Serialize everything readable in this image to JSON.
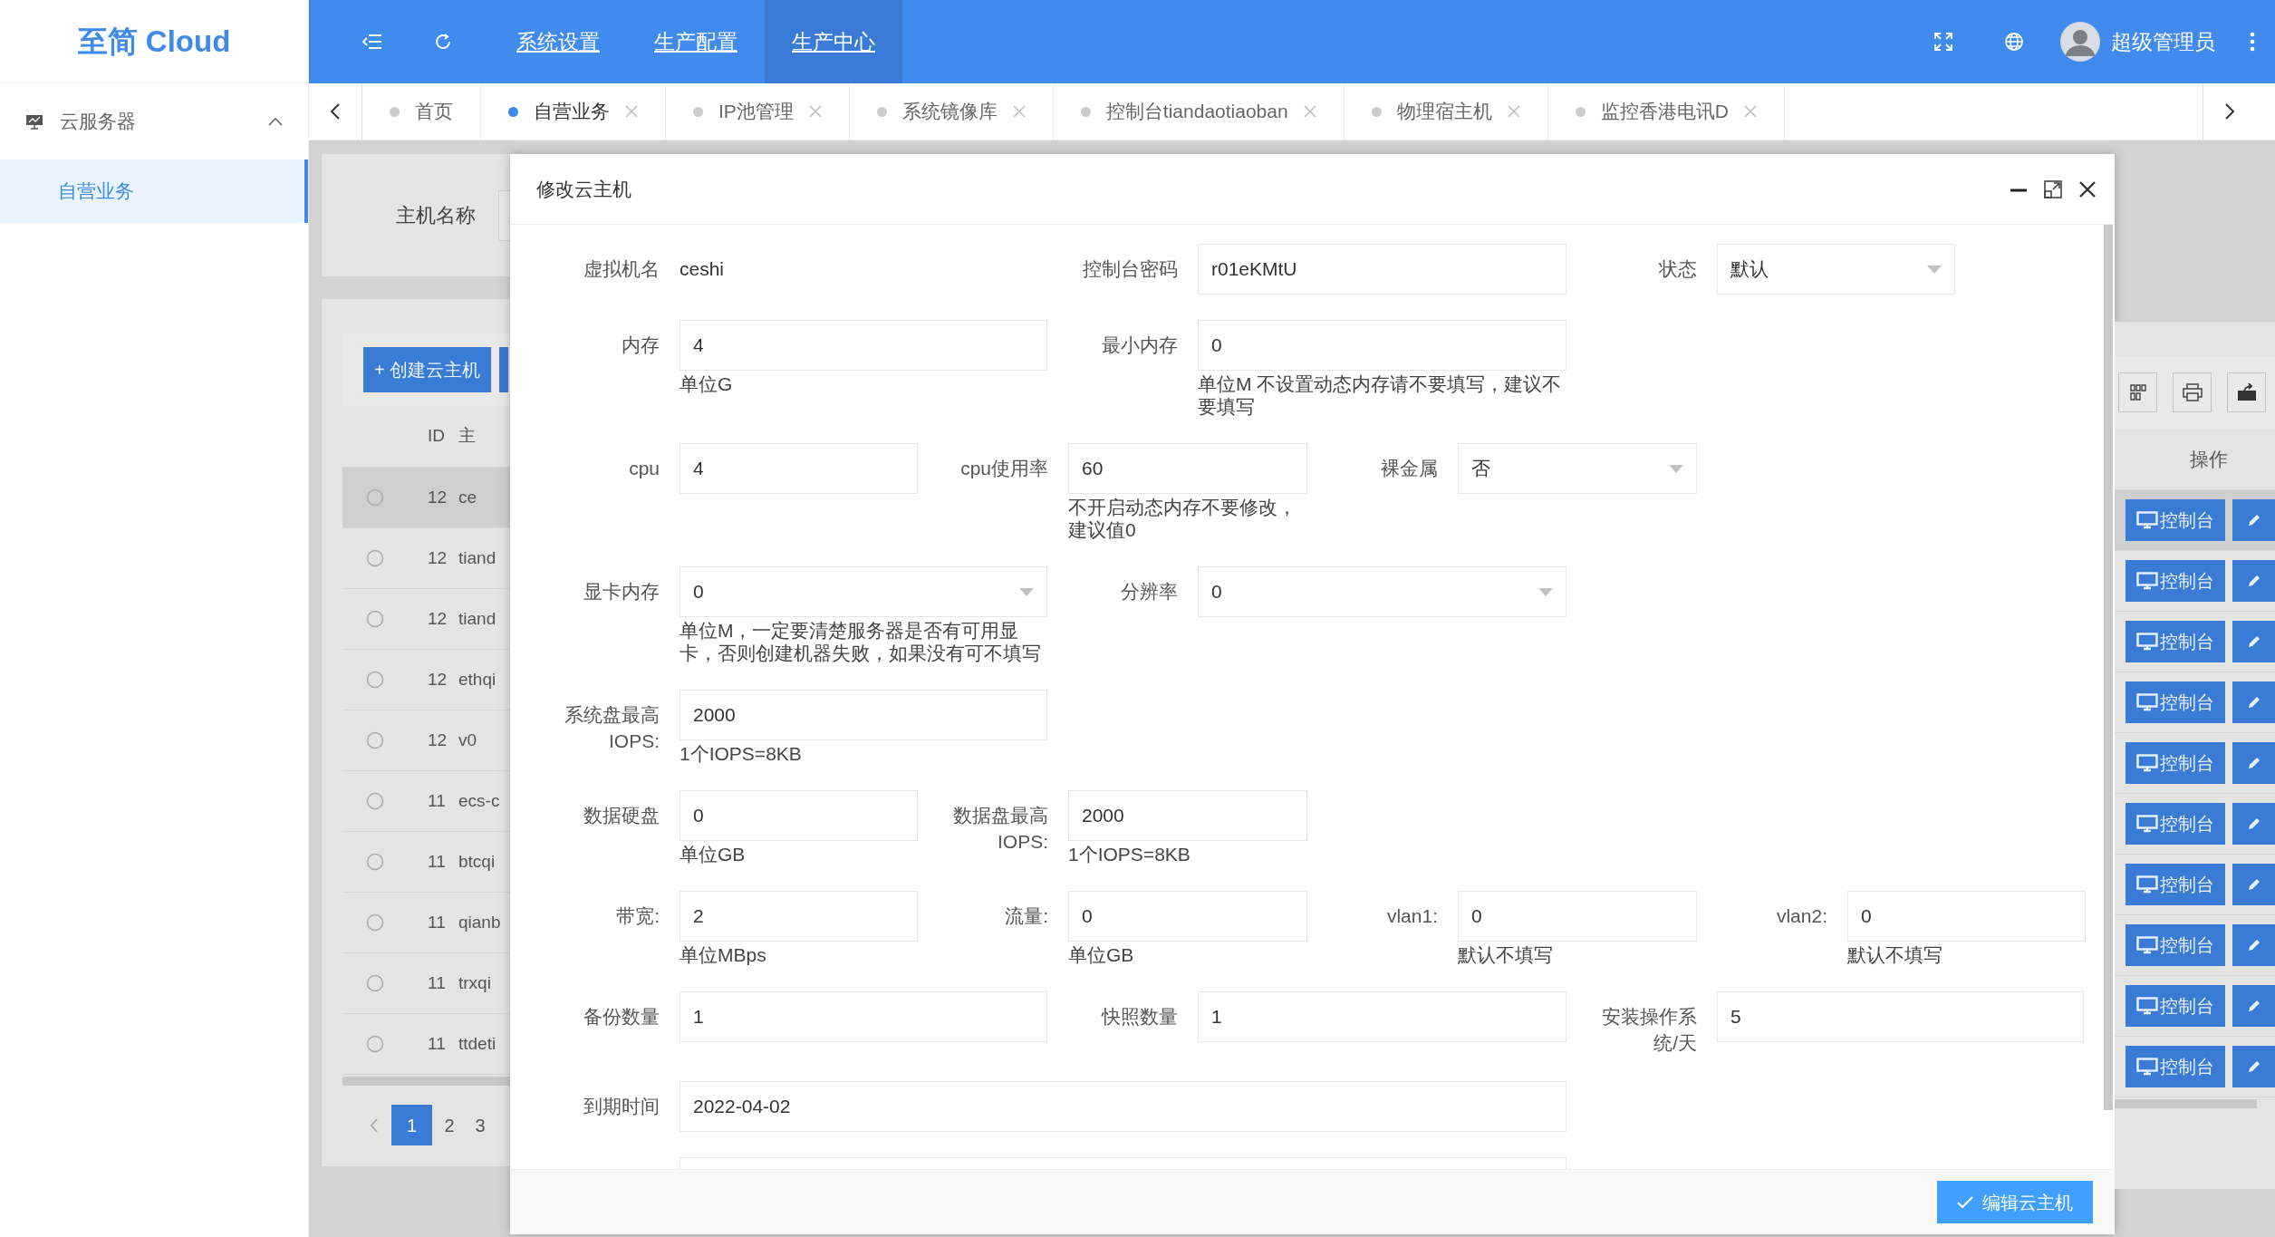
{
  "app": {
    "logo": "至简 Cloud"
  },
  "header": {
    "nav": [
      {
        "label": "系统设置",
        "selected": false
      },
      {
        "label": "生产配置",
        "selected": false
      },
      {
        "label": "生产中心",
        "selected": true
      }
    ],
    "user": "超级管理员"
  },
  "sidebar": {
    "groups": [
      {
        "label": "云服务器",
        "expanded": true,
        "children": [
          {
            "label": "自营业务",
            "selected": true
          }
        ]
      }
    ]
  },
  "tabs": [
    {
      "label": "首页",
      "selected": false,
      "closable": false
    },
    {
      "label": "自营业务",
      "selected": true,
      "closable": true
    },
    {
      "label": "IP池管理",
      "selected": false,
      "closable": true
    },
    {
      "label": "系统镜像库",
      "selected": false,
      "closable": true
    },
    {
      "label": "控制台tiandaotiaoban",
      "selected": false,
      "closable": true
    },
    {
      "label": "物理宿主机",
      "selected": false,
      "closable": true
    },
    {
      "label": "监控香港电讯D",
      "selected": false,
      "closable": true
    }
  ],
  "background": {
    "filter_label": "主机名称",
    "create_button": "+ 创建云主机",
    "columns": [
      "ID",
      "主"
    ],
    "action_column": "操作",
    "rows": [
      {
        "id": "12",
        "name": "ce",
        "highlighted": true,
        "checked": false,
        "action": "控制台"
      },
      {
        "id": "12",
        "name": "tiand",
        "highlighted": false,
        "checked": false,
        "action": "控制台"
      },
      {
        "id": "12",
        "name": "tiand",
        "highlighted": false,
        "checked": false,
        "action": "控制台"
      },
      {
        "id": "12",
        "name": "ethqi",
        "highlighted": false,
        "checked": false,
        "action": "控制台"
      },
      {
        "id": "12",
        "name": "v0",
        "highlighted": false,
        "checked": false,
        "action": "控制台"
      },
      {
        "id": "11",
        "name": "ecs-c",
        "highlighted": false,
        "checked": false,
        "action": "控制台"
      },
      {
        "id": "11",
        "name": "btcqi",
        "highlighted": false,
        "checked": false,
        "action": "控制台"
      },
      {
        "id": "11",
        "name": "qianb",
        "highlighted": false,
        "checked": false,
        "action": "控制台"
      },
      {
        "id": "11",
        "name": "trxqi",
        "highlighted": false,
        "checked": false,
        "action": "控制台"
      },
      {
        "id": "11",
        "name": "ttdeti",
        "highlighted": false,
        "checked": false,
        "action": "控制台"
      }
    ],
    "pages": [
      {
        "label": "1",
        "selected": true
      },
      {
        "label": "2",
        "selected": false
      },
      {
        "label": "3",
        "selected": false
      }
    ]
  },
  "modal": {
    "title": "修改云主机",
    "submit": "编辑云主机",
    "rows": [
      [
        {
          "label": "虚拟机名",
          "kind": "text",
          "value": "ceshi"
        },
        {
          "label": "控制台密码",
          "kind": "input",
          "value": "r01eKMtU"
        },
        {
          "label": "状态",
          "kind": "select",
          "value": "默认"
        }
      ],
      [
        {
          "label": "内存",
          "kind": "input",
          "value": "4",
          "help": "单位G"
        },
        {
          "label": "最小内存",
          "kind": "input",
          "value": "0",
          "help": "单位M 不设置动态内存请不要填写，建议不要填写"
        }
      ],
      [
        {
          "label": "cpu",
          "kind": "input",
          "value": "4"
        },
        {
          "label": "cpu使用率",
          "kind": "input",
          "value": "60",
          "help": "不开启动态内存不要修改，建议值0"
        },
        {
          "label": "裸金属",
          "kind": "select",
          "value": "否"
        }
      ],
      [
        {
          "label": "显卡内存",
          "kind": "select",
          "value": "0",
          "help": "单位M，一定要清楚服务器是否有可用显卡，否则创建机器失败，如果没有可不填写"
        },
        {
          "label": "分辨率",
          "kind": "select",
          "value": "0"
        }
      ],
      [
        {
          "label": "系统盘最高IOPS:",
          "kind": "input",
          "value": "2000",
          "help": "1个IOPS=8KB"
        }
      ],
      [
        {
          "label": "数据硬盘",
          "kind": "input",
          "value": "0",
          "help": "单位GB"
        },
        {
          "label": "数据盘最高IOPS:",
          "kind": "input",
          "value": "2000",
          "help": "1个IOPS=8KB"
        }
      ],
      [
        {
          "label": "带宽:",
          "kind": "input",
          "value": "2",
          "help": "单位MBps"
        },
        {
          "label": "流量:",
          "kind": "input",
          "value": "0",
          "help": "单位GB"
        },
        {
          "label": "vlan1:",
          "kind": "input",
          "value": "0",
          "help": "默认不填写"
        },
        {
          "label": "vlan2:",
          "kind": "input",
          "value": "0",
          "help": "默认不填写"
        }
      ],
      [
        {
          "label": "备份数量",
          "kind": "input",
          "value": "1"
        },
        {
          "label": "快照数量",
          "kind": "input",
          "value": "1"
        },
        {
          "label": "安装操作系统/天",
          "kind": "input",
          "value": "5"
        }
      ],
      [
        {
          "label": "到期时间",
          "kind": "input",
          "value": "2022-04-02"
        }
      ],
      [
        {
          "kind": "input"
        }
      ]
    ]
  }
}
